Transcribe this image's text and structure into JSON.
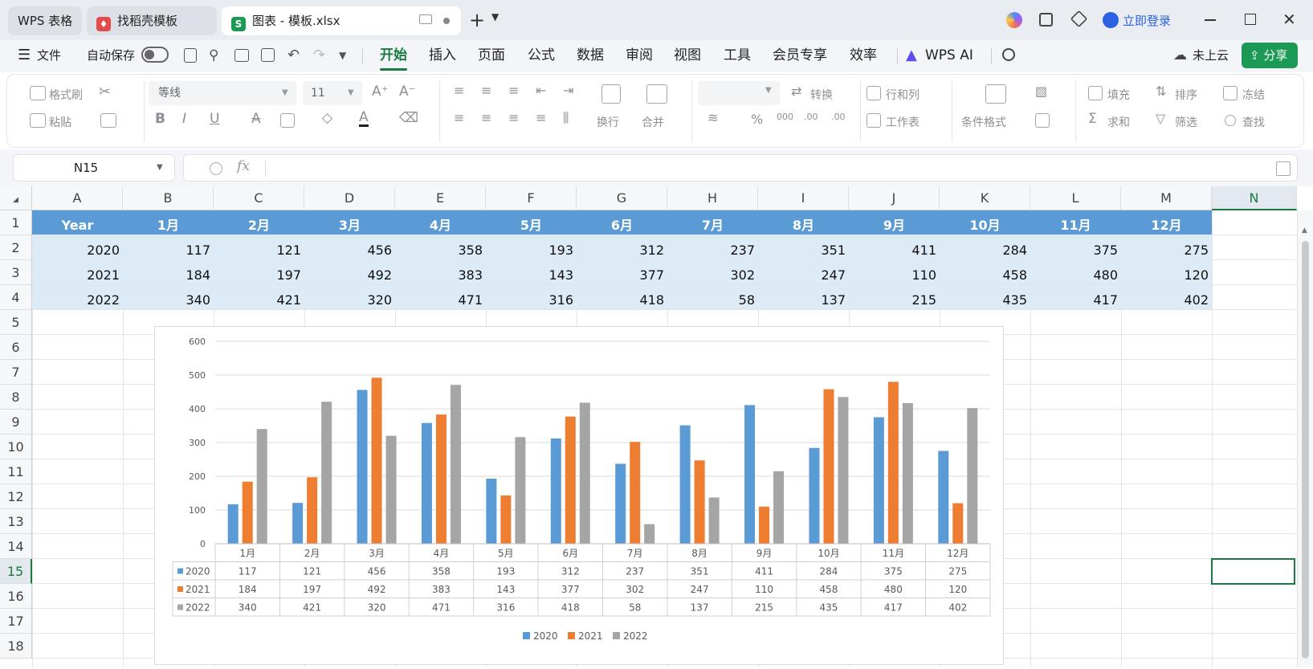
{
  "tabs": [
    {
      "label": "WPS 表格"
    },
    {
      "label": "找稻壳模板"
    },
    {
      "label": "图表 - 模板.xlsx"
    }
  ],
  "titlebar": {
    "login_label": "立即登录"
  },
  "menu": {
    "file": "文件",
    "autosave": "自动保存",
    "items": [
      "开始",
      "插入",
      "页面",
      "公式",
      "数据",
      "审阅",
      "视图",
      "工具",
      "会员专享",
      "效率"
    ],
    "wps_ai": "WPS AI",
    "cloud": "未上云",
    "share": "分享"
  },
  "ribbon": {
    "format_painter": "格式刷",
    "paste": "粘贴",
    "font_name": "等线",
    "font_size": "11",
    "wrap": "换行",
    "merge": "合并",
    "convert": "转换",
    "rows_cols": "行和列",
    "worksheet": "工作表",
    "cond_format": "条件格式",
    "fill": "填充",
    "sort": "排序",
    "freeze": "冻结",
    "sum": "求和",
    "filter": "筛选",
    "find": "查找"
  },
  "formula": {
    "name_box": "N15",
    "content": ""
  },
  "sheet": {
    "columns": [
      "A",
      "B",
      "C",
      "D",
      "E",
      "F",
      "G",
      "H",
      "I",
      "J",
      "K",
      "L",
      "M",
      "N"
    ],
    "rows": [
      "1",
      "2",
      "3",
      "4",
      "5",
      "6",
      "7",
      "8",
      "9",
      "10",
      "11",
      "12",
      "13",
      "14",
      "15",
      "16",
      "17",
      "18"
    ],
    "header": [
      "Year",
      "1月",
      "2月",
      "3月",
      "4月",
      "5月",
      "6月",
      "7月",
      "8月",
      "9月",
      "10月",
      "11月",
      "12月"
    ],
    "data": [
      [
        "2020",
        "117",
        "121",
        "456",
        "358",
        "193",
        "312",
        "237",
        "351",
        "411",
        "284",
        "375",
        "275"
      ],
      [
        "2021",
        "184",
        "197",
        "492",
        "383",
        "143",
        "377",
        "302",
        "247",
        "110",
        "458",
        "480",
        "120"
      ],
      [
        "2022",
        "340",
        "421",
        "320",
        "471",
        "316",
        "418",
        "58",
        "137",
        "215",
        "435",
        "417",
        "402"
      ]
    ],
    "selected_cell": "N15",
    "colors": {
      "header_fill": "#5b9bd5",
      "data_fill": "#ddebf7",
      "selection": "#1a7a41"
    }
  },
  "chart_data": {
    "type": "bar",
    "categories": [
      "1月",
      "2月",
      "3月",
      "4月",
      "5月",
      "6月",
      "7月",
      "8月",
      "9月",
      "10月",
      "11月",
      "12月"
    ],
    "series": [
      {
        "name": "2020",
        "color": "#5b9bd5",
        "values": [
          117,
          121,
          456,
          358,
          193,
          312,
          237,
          351,
          411,
          284,
          375,
          275
        ]
      },
      {
        "name": "2021",
        "color": "#ed7d31",
        "values": [
          184,
          197,
          492,
          383,
          143,
          377,
          302,
          247,
          110,
          458,
          480,
          120
        ]
      },
      {
        "name": "2022",
        "color": "#a5a5a5",
        "values": [
          340,
          421,
          320,
          471,
          316,
          418,
          58,
          137,
          215,
          435,
          417,
          402
        ]
      }
    ],
    "y_ticks": [
      "0",
      "100",
      "200",
      "300",
      "400",
      "500",
      "600"
    ],
    "ylim": [
      0,
      600
    ],
    "grid": true,
    "data_table": true,
    "legend": "bottom"
  }
}
